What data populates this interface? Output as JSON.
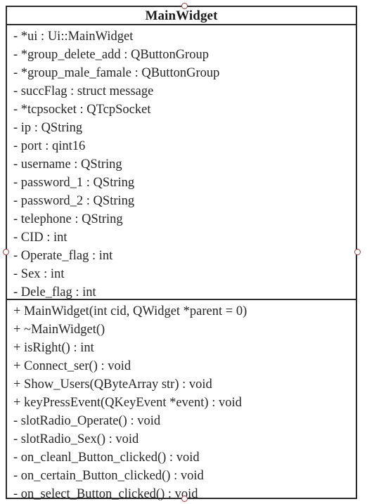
{
  "diagram": {
    "type": "uml-class-diagram",
    "notation": "UML",
    "background_color": "#ffffff",
    "border_color": "#2b2b2b",
    "text_color": "#262626",
    "connection_point_color": "#a33b42"
  },
  "class": {
    "name": "MainWidget",
    "stereotype": "",
    "attributes": [
      {
        "visibility": "-",
        "text": "- *ui : Ui::MainWidget"
      },
      {
        "visibility": "-",
        "text": "- *group_delete_add : QButtonGroup"
      },
      {
        "visibility": "-",
        "text": "- *group_male_famale : QButtonGroup"
      },
      {
        "visibility": "-",
        "text": "- succFlag : struct message"
      },
      {
        "visibility": "-",
        "text": "- *tcpsocket : QTcpSocket"
      },
      {
        "visibility": "-",
        "text": "- ip : QString"
      },
      {
        "visibility": "-",
        "text": "- port : qint16"
      },
      {
        "visibility": "-",
        "text": "- username : QString"
      },
      {
        "visibility": "-",
        "text": "- password_1 : QString"
      },
      {
        "visibility": "-",
        "text": "- password_2 : QString"
      },
      {
        "visibility": "-",
        "text": "- telephone : QString"
      },
      {
        "visibility": "-",
        "text": "- CID : int"
      },
      {
        "visibility": "-",
        "text": "- Operate_flag : int"
      },
      {
        "visibility": "-",
        "text": "- Sex : int"
      },
      {
        "visibility": "-",
        "text": "- Dele_flag : int"
      }
    ],
    "operations": [
      {
        "visibility": "+",
        "text": "+ MainWidget(int cid, QWidget *parent = 0)"
      },
      {
        "visibility": "+",
        "text": "+ ~MainWidget()"
      },
      {
        "visibility": "+",
        "text": "+ isRight() : int"
      },
      {
        "visibility": "+",
        "text": "+ Connect_ser() : void"
      },
      {
        "visibility": "+",
        "text": "+ Show_Users(QByteArray str) : void"
      },
      {
        "visibility": "+",
        "text": "+ keyPressEvent(QKeyEvent *event) : void"
      },
      {
        "visibility": "-",
        "text": "- slotRadio_Operate() : void"
      },
      {
        "visibility": "-",
        "text": "- slotRadio_Sex() : void"
      },
      {
        "visibility": "-",
        "text": "- on_cleanl_Button_clicked() : void"
      },
      {
        "visibility": "-",
        "text": "- on_certain_Button_clicked() : void"
      },
      {
        "visibility": "-",
        "text": "- on_select_Button_clicked() : void"
      }
    ]
  },
  "connection_points": [
    {
      "position": "top"
    },
    {
      "position": "bottom"
    },
    {
      "position": "left"
    },
    {
      "position": "right"
    }
  ]
}
